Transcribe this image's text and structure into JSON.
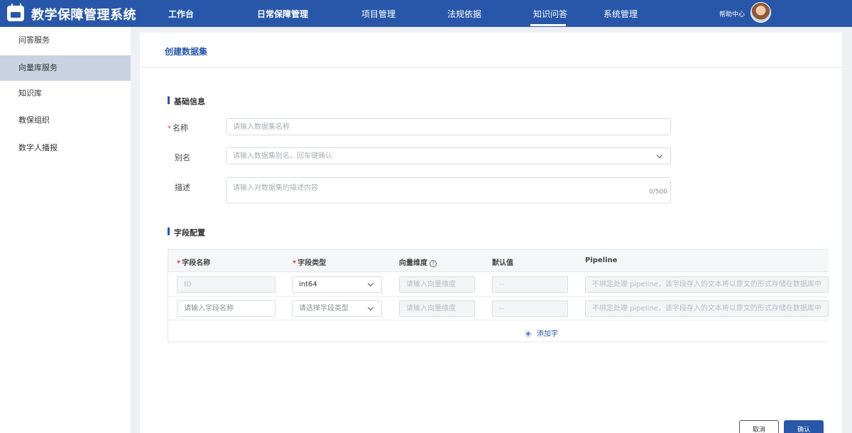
{
  "app": {
    "title": "教学保障管理系统"
  },
  "nav": [
    {
      "label": "工作台"
    },
    {
      "label": "日常保障管理"
    },
    {
      "label": "项目管理"
    },
    {
      "label": "法规依据"
    },
    {
      "label": "知识问答",
      "active": true
    },
    {
      "label": "系统管理"
    }
  ],
  "header": {
    "help": "帮助中心"
  },
  "sidebar": {
    "items": [
      {
        "label": "问答服务"
      },
      {
        "label": "向量库服务",
        "active": true
      },
      {
        "label": "知识库"
      },
      {
        "label": "教保组织"
      },
      {
        "label": "数字人播报"
      }
    ]
  },
  "page": {
    "title": "创建数据集"
  },
  "basic": {
    "section_title": "基础信息",
    "name_label": "名称",
    "name_placeholder": "请输入数据集名称",
    "alias_label": "别名",
    "alias_placeholder": "请输入数据集别名，回车键确认",
    "desc_label": "描述",
    "desc_placeholder": "请输入对数据集的描述内容",
    "desc_counter": "0/500"
  },
  "fields": {
    "section_title": "字段配置",
    "columns": {
      "name": "字段名称",
      "type": "字段类型",
      "dim": "向量维度",
      "default": "默认值",
      "pipeline": "Pipeline"
    },
    "rows": [
      {
        "name": "ID",
        "type": "int64",
        "dim": "请输入向量维度",
        "default": "--",
        "pipeline": "不绑定处理 pipeline，该字段存入的文本将以原文的形式存储在数据库中"
      },
      {
        "name": "请输入字段名称",
        "type": "请选择字段类型",
        "dim": "请输入向量维度",
        "default": "--",
        "pipeline": "不绑定处理 pipeline，该字段存入的文本将以原文的形式存储在数据库中"
      }
    ],
    "add_label": "添加字"
  },
  "actions": {
    "cancel": "取消",
    "confirm": "确认"
  },
  "colors": {
    "brand": "#2857a9",
    "required": "#e23c3c"
  }
}
